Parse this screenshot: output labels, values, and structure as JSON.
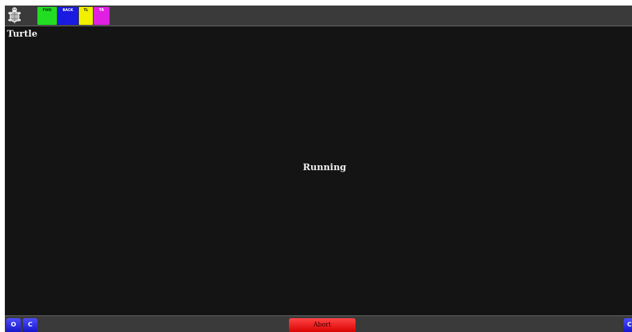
{
  "app": {
    "title": "Turtle"
  },
  "toolbar": {
    "icon": "turtle-icon",
    "blocks": [
      {
        "label": "FWD",
        "color": "#22dd22"
      },
      {
        "label": "BACK",
        "color": "#1a1ae0"
      },
      {
        "label": "TL",
        "color": "#f0f000"
      },
      {
        "label": "TR",
        "color": "#e020e0"
      }
    ]
  },
  "stage": {
    "status": "Running"
  },
  "bottom_bar": {
    "left_buttons": [
      {
        "label": "O"
      },
      {
        "label": "C"
      }
    ],
    "abort_label": "Abort",
    "right_button": {
      "label": "C"
    }
  }
}
